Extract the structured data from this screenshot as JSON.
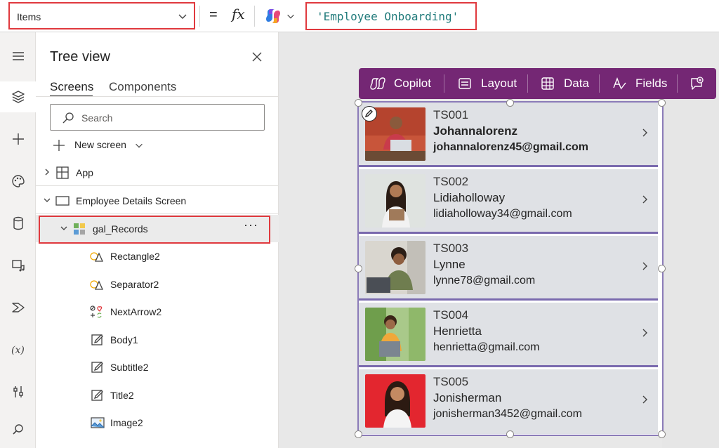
{
  "formula_bar": {
    "property": "Items",
    "equals": "=",
    "fx": "fx",
    "formula": "'Employee Onboarding'"
  },
  "tree_view": {
    "title": "Tree view",
    "tabs": [
      {
        "label": "Screens",
        "active": true
      },
      {
        "label": "Components",
        "active": false
      }
    ],
    "search_placeholder": "Search",
    "new_screen_label": "New screen",
    "nodes": {
      "app": "App",
      "screen": "Employee Details Screen",
      "gallery": "gal_Records",
      "gallery_more": "···",
      "children": [
        "Rectangle2",
        "Separator2",
        "NextArrow2",
        "Body1",
        "Subtitle2",
        "Title2",
        "Image2"
      ]
    }
  },
  "toolbar": {
    "copilot": "Copilot",
    "layout": "Layout",
    "data": "Data",
    "fields": "Fields"
  },
  "gallery": {
    "records": [
      {
        "id": "TS001",
        "name": "Johannalorenz",
        "email": "johannalorenz45@gmail.com",
        "photo_bg": "#c8553a"
      },
      {
        "id": "TS002",
        "name": "Lidiaholloway",
        "email": "lidiaholloway34@gmail.com",
        "photo_bg": "#dfe3e0"
      },
      {
        "id": "TS003",
        "name": "Lynne",
        "email": "lynne78@gmail.com",
        "photo_bg": "#d9d6cf"
      },
      {
        "id": "TS004",
        "name": "Henrietta",
        "email": "henrietta@gmail.com",
        "photo_bg": "#a9c98a"
      },
      {
        "id": "TS005",
        "name": "Jonisherman",
        "email": "jonisherman3452@gmail.com",
        "photo_bg": "#e3262f"
      }
    ]
  },
  "colors": {
    "toolbar_bg": "#742774",
    "highlight": "#e0393e",
    "card_bg": "#dfe1e5",
    "card_divider": "#7a6aae"
  }
}
